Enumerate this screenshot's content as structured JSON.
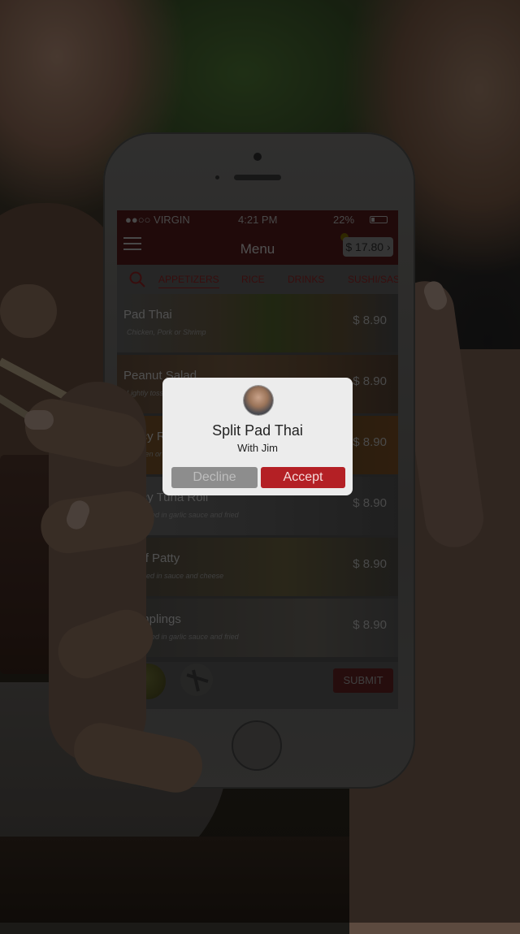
{
  "status_bar": {
    "carrier": "●●○○ VIRGIN ",
    "time": "4:21 PM",
    "battery": "22%"
  },
  "nav": {
    "title": "Menu",
    "cart_total": "$ 17.80 ›"
  },
  "tabs": [
    "APPETIZERS",
    "RICE",
    "DRINKS",
    "SUSHI/SASHIMI"
  ],
  "items": [
    {
      "name": "Pad Thai",
      "desc": "Chicken, Pork or Shrimp",
      "price": "$ 8.90"
    },
    {
      "name": "Peanut Salad",
      "desc": "Lightly tossed",
      "price": "$ 8.90"
    },
    {
      "name": "Spicy Rolls",
      "desc": "Chicken or",
      "price": "$ 8.90"
    },
    {
      "name": "Spicy Tuna Roll",
      "desc": "Marinated in garlic sauce and fried",
      "price": "$ 8.90"
    },
    {
      "name": "Beef Patty",
      "desc": "Covered in sauce and cheese",
      "price": "$ 8.90"
    },
    {
      "name": "Dumplings",
      "desc": "Marinated in garlic sauce and fried",
      "price": "$ 8.90"
    }
  ],
  "bottom_bar": {
    "submit_label": "SUBMIT"
  },
  "dialog": {
    "title": "Split Pad Thai",
    "subtitle": "With Jim",
    "decline_label": "Decline",
    "accept_label": "Accept"
  },
  "colors": {
    "accent": "#b42025",
    "navbar": "#3e1414",
    "overlay": "rgba(0,0,0,0.6)"
  }
}
